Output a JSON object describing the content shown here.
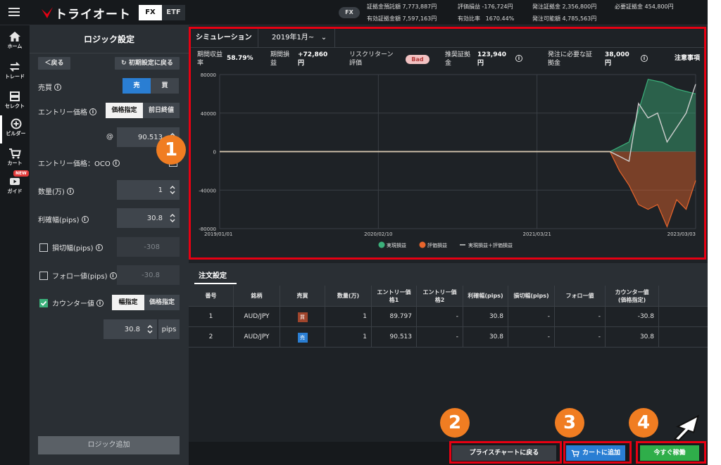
{
  "header": {
    "logo_text": "トライオート",
    "markets": [
      "FX",
      "ETF"
    ],
    "market_pill": "FX",
    "account": {
      "deposit_label": "証拠金預託額",
      "deposit_value": "7,773,887円",
      "unrealized_label": "評価損益",
      "unrealized_value": "-176,724円",
      "order_margin_label": "発注証拠金",
      "order_margin_value": "2,356,800円",
      "required_margin_label": "必要証拠金",
      "required_margin_value": "454,800円",
      "effective_margin_label": "有効証拠金額",
      "effective_margin_value": "7,597,163円",
      "effective_ratio_label": "有効比率",
      "effective_ratio_value": "1670.44%",
      "orderable_label": "発注可能額",
      "orderable_value": "4,785,563円"
    }
  },
  "nav": {
    "items": [
      {
        "label": "ホーム",
        "icon": "home-icon"
      },
      {
        "label": "トレード",
        "icon": "trade-icon"
      },
      {
        "label": "セレクト",
        "icon": "select-icon"
      },
      {
        "label": "ビルダー",
        "icon": "builder-icon"
      },
      {
        "label": "カート",
        "icon": "cart-icon"
      },
      {
        "label": "ガイド",
        "icon": "guide-icon"
      }
    ],
    "new_badge": "NEW"
  },
  "logic": {
    "title": "ロジック設定",
    "back_label": "戻る",
    "reset_label": "初期設定に戻る",
    "side_label": "売買",
    "side_options": [
      "売",
      "買"
    ],
    "entry_price_label": "エントリー価格",
    "entry_price_options": [
      "価格指定",
      "前日終値"
    ],
    "at_sign": "@",
    "entry_price_value": "90.513",
    "oco_label": "エントリー価格：OCO",
    "quantity_label": "数量(万)",
    "quantity_value": "1",
    "take_profit_label": "利確幅(pips)",
    "take_profit_value": "30.8",
    "stop_loss_label": "損切幅(pips)",
    "stop_loss_value": "-308",
    "follow_label": "フォロー値(pips)",
    "follow_value": "-30.8",
    "counter_label": "カウンター値",
    "counter_options": [
      "幅指定",
      "価格指定"
    ],
    "counter_value": "30.8",
    "counter_unit": "pips",
    "add_logic_label": "ロジック追加"
  },
  "simulation": {
    "tab_label": "シミュレーション",
    "period_label": "2019年1月~",
    "stats": {
      "return_label_1": "期間収益",
      "return_label_2": "率",
      "return_value": "58.79%",
      "pl_label_1": "期間損",
      "pl_label_2": "益",
      "pl_value_1": "+72,860",
      "pl_value_2": "円",
      "risk_label_1": "リスクリターン",
      "risk_label_2": "評価",
      "risk_value": "Bad",
      "rec_label_1": "推奨証拠",
      "rec_label_2": "金",
      "rec_value_1": "123,940",
      "rec_value_2": "円",
      "req_label_1": "発注に必要な証",
      "req_label_2": "拠金",
      "req_value_1": "38,000",
      "req_value_2": "円",
      "notes_label": "注意事項"
    }
  },
  "chart_data": {
    "type": "area",
    "x_ticks": [
      "2019/01/01",
      "2020/02/10",
      "2021/03/21",
      "2023/03/03"
    ],
    "y_ticks": [
      80000,
      40000,
      0,
      -40000,
      -80000
    ],
    "ylim": [
      -80000,
      80000
    ],
    "legend_position": "bottom-center",
    "grid": true,
    "series": [
      {
        "name": "実現損益",
        "color": "#3bb07a",
        "values_x": [
          0,
          0.82,
          0.86,
          0.9,
          0.93,
          0.96,
          1.0
        ],
        "values": [
          0,
          0,
          10000,
          75000,
          72000,
          65000,
          60000
        ]
      },
      {
        "name": "評価損益",
        "color": "#e8652c",
        "values_x": [
          0,
          0.82,
          0.84,
          0.86,
          0.88,
          0.9,
          0.92,
          0.94,
          0.96,
          0.98,
          1.0
        ],
        "values": [
          0,
          0,
          -20000,
          -35000,
          -55000,
          -60000,
          -55000,
          -78000,
          -50000,
          -60000,
          -30000
        ]
      },
      {
        "name": "実現損益＋評価損益",
        "color": "#cfcfcf",
        "values_x": [
          0,
          0.82,
          0.84,
          0.86,
          0.88,
          0.9,
          0.92,
          0.94,
          0.96,
          0.98,
          1.0
        ],
        "values": [
          0,
          0,
          -5000,
          -10000,
          50000,
          35000,
          40000,
          10000,
          25000,
          40000,
          70000
        ]
      }
    ]
  },
  "orders": {
    "title": "注文設定",
    "columns": [
      "番号",
      "銘柄",
      "売買",
      "数量(万)",
      "エントリー価格1",
      "エントリー価格2",
      "利確幅(pips)",
      "損切幅(pips)",
      "フォロー値",
      "カウンター値(価格指定)"
    ],
    "rows": [
      {
        "no": "1",
        "symbol": "AUD/JPY",
        "side": "買",
        "side_color": "#a0452c",
        "qty": "1",
        "price1": "89.797",
        "price2": "-",
        "tp": "30.8",
        "sl": "-",
        "follow": "-",
        "counter": "-30.8"
      },
      {
        "no": "2",
        "symbol": "AUD/JPY",
        "side": "売",
        "side_color": "#2a7ed3",
        "qty": "1",
        "price1": "90.513",
        "price2": "-",
        "tp": "30.8",
        "sl": "-",
        "follow": "-",
        "counter": "30.8"
      }
    ]
  },
  "actions": {
    "back_to_chart": "プライスチャートに戻る",
    "add_to_cart": "カートに追加",
    "run_now": "今すぐ稼働"
  },
  "annotations": [
    "1",
    "2",
    "3",
    "4"
  ]
}
